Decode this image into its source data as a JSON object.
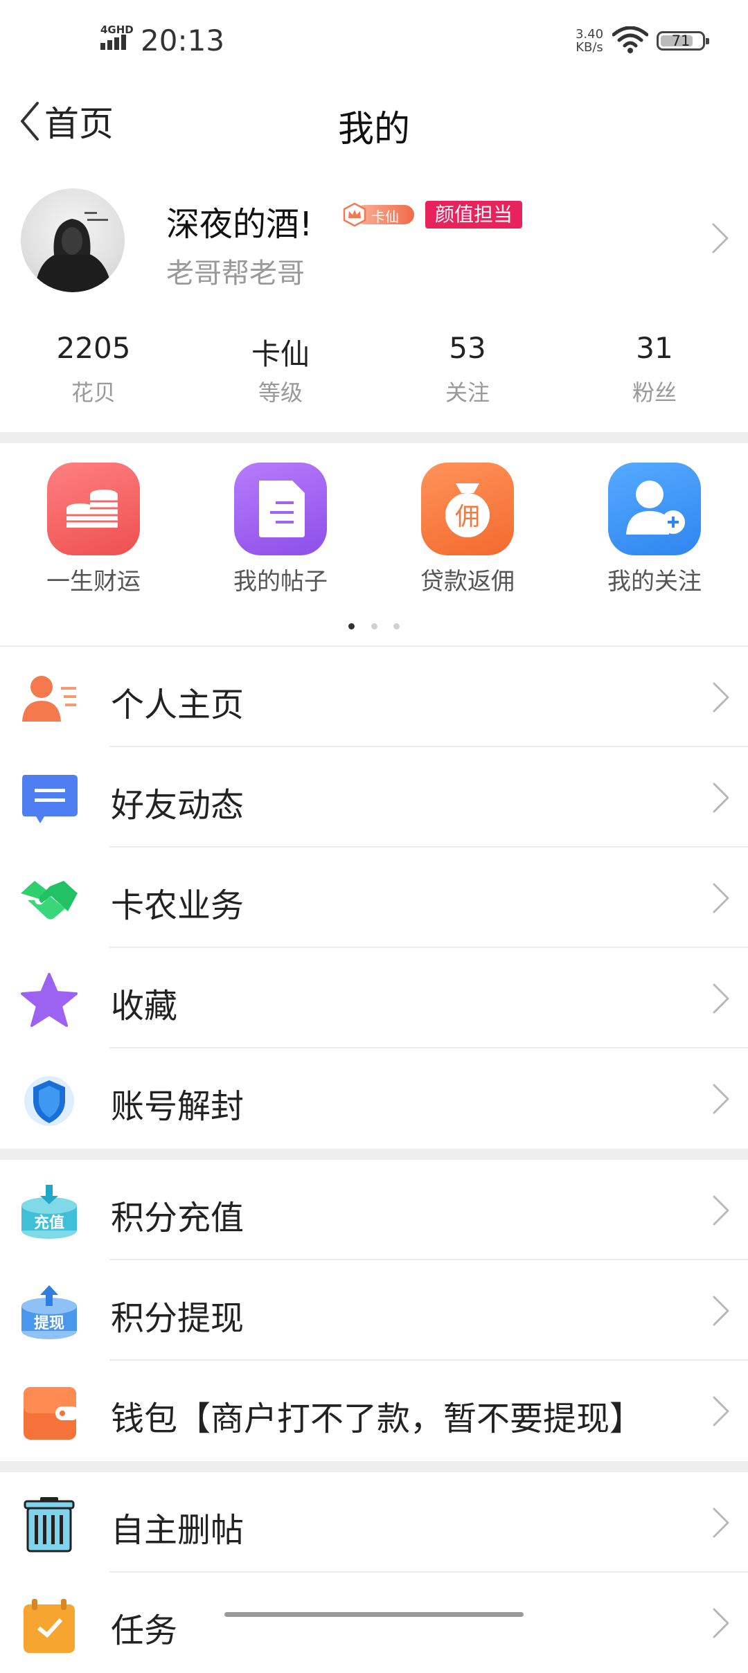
{
  "status_bar": {
    "network": "4GHD",
    "time": "20:13",
    "speed_value": "3.40",
    "speed_unit": "KB/s",
    "battery": "71"
  },
  "nav": {
    "back_label": "首页",
    "title": "我的"
  },
  "profile": {
    "nickname": "深夜的酒!",
    "level_badge": "卡仙",
    "tag": "颜值担当",
    "signature": "老哥帮老哥"
  },
  "stats": [
    {
      "value": "2205",
      "label": "花贝"
    },
    {
      "value": "卡仙",
      "label": "等级"
    },
    {
      "value": "53",
      "label": "关注"
    },
    {
      "value": "31",
      "label": "粉丝"
    }
  ],
  "grid": [
    {
      "label": "一生财运",
      "icon": "coins-icon",
      "color": "#f26262"
    },
    {
      "label": "我的帖子",
      "icon": "post-icon",
      "color": "#9b5cf0"
    },
    {
      "label": "贷款返佣",
      "icon": "money-bag-icon",
      "color": "#f7773a"
    },
    {
      "label": "我的关注",
      "icon": "user-add-icon",
      "color": "#3b93f5"
    }
  ],
  "pager": {
    "pages": 3,
    "current": 1
  },
  "menu": [
    {
      "label": "个人主页",
      "icon": "profile-card-icon"
    },
    {
      "label": "好友动态",
      "icon": "chat-bubble-icon"
    },
    {
      "label": "卡农业务",
      "icon": "handshake-icon"
    },
    {
      "label": "收藏",
      "icon": "star-icon"
    },
    {
      "label": "账号解封",
      "icon": "shield-icon"
    },
    {
      "label": "积分充值",
      "icon": "recharge-icon",
      "icon_text": "充值"
    },
    {
      "label": "积分提现",
      "icon": "withdraw-icon",
      "icon_text": "提现"
    },
    {
      "label": "钱包【商户打不了款，暂不要提现】",
      "icon": "wallet-icon"
    },
    {
      "label": "自主删帖",
      "icon": "trash-icon"
    },
    {
      "label": "任务",
      "icon": "calendar-icon"
    }
  ]
}
